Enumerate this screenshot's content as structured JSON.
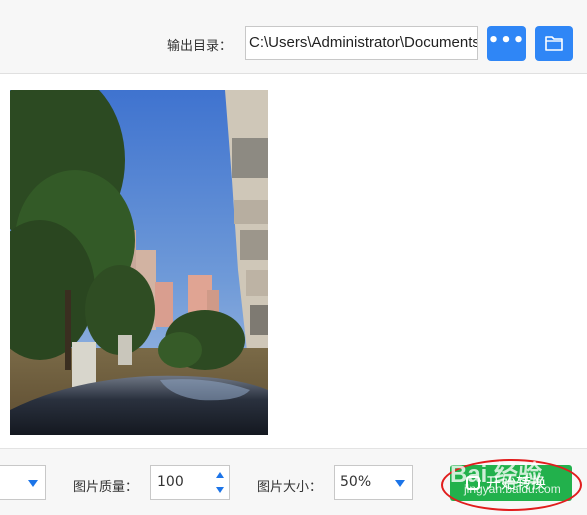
{
  "output": {
    "label": "输出目录：",
    "path": "C:\\Users\\Administrator\\Documents",
    "more_label": "•••"
  },
  "settings": {
    "quality_label": "图片质量：",
    "quality_value": "100",
    "size_label": "图片大小：",
    "size_value": "50%",
    "start_label": "开始转换"
  },
  "watermark": {
    "brand": "Bai 经验",
    "url": "jingyan.baidu.com"
  },
  "colors": {
    "accent_blue": "#2f86f6",
    "start_green": "#22b14c",
    "annotation_red": "#e11d1d"
  }
}
